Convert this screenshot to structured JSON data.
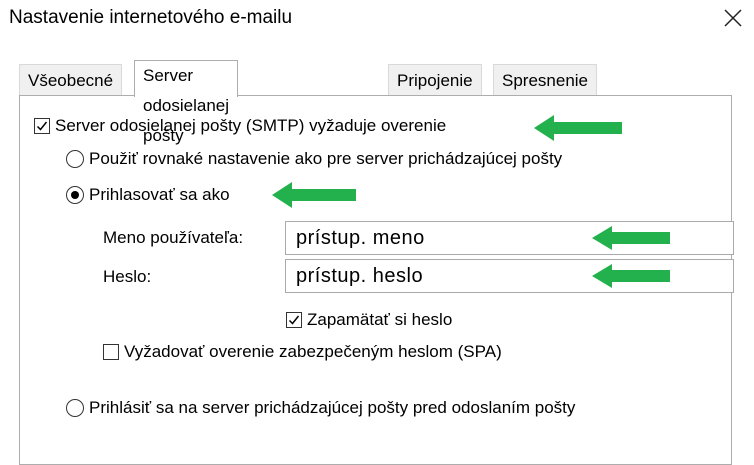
{
  "dialog": {
    "title": "Nastavenie internetového e-mailu"
  },
  "tabs": [
    {
      "label": "Všeobecné"
    },
    {
      "label": "Server odosielanej pošty"
    },
    {
      "label": "Pripojenie"
    },
    {
      "label": "Spresnenie"
    }
  ],
  "outgoing": {
    "requires_auth": {
      "label": "Server odosielanej pošty (SMTP) vyžaduje overenie",
      "checked": true
    },
    "same_settings": {
      "label": "Použiť rovnaké nastavenie ako pre server prichádzajúcej pošty",
      "selected": false
    },
    "log_on_using": {
      "label": "Prihlasovať sa ako",
      "selected": true
    },
    "username": {
      "label": "Meno používateľa:",
      "value": "prístup. meno"
    },
    "password": {
      "label": "Heslo:",
      "value": "prístup. heslo"
    },
    "remember_password": {
      "label": "Zapamätať si heslo",
      "checked": true
    },
    "require_spa": {
      "label": "Vyžadovať overenie zabezpečeným heslom (SPA)",
      "checked": false
    },
    "log_on_incoming_first": {
      "label": "Prihlásiť sa na server prichádzajúcej pošty pred odoslaním pošty",
      "selected": false
    }
  },
  "icons": {
    "close": "close-icon",
    "checkmark": "checkmark-icon",
    "annotation": "green-arrow-icon"
  },
  "colors": {
    "annotation_arrow": "#22b14c",
    "panel_border": "#adadad"
  }
}
